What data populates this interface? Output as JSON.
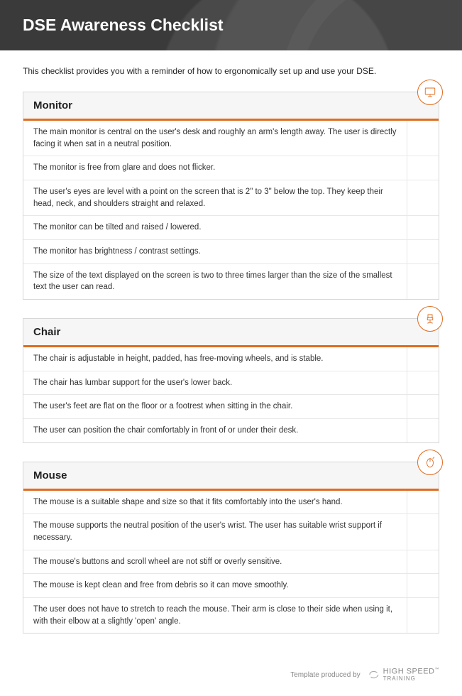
{
  "header": {
    "title": "DSE Awareness Checklist"
  },
  "intro": "This checklist provides you with a reminder of how to ergonomically set up and use your DSE.",
  "sections": [
    {
      "title": "Monitor",
      "items": [
        "The main monitor is central on the user's desk and roughly an arm's length away. The user is directly facing it when sat in a neutral position.",
        "The monitor is free from glare and does not flicker.",
        "The user's eyes are level with a point on the screen that is 2\" to 3\" below the top. They keep their head, neck, and shoulders straight and relaxed.",
        "The monitor can be tilted and raised / lowered.",
        "The monitor has brightness / contrast settings.",
        "The size of the text displayed on the screen is two to three times larger than the size of the smallest text the user can read."
      ]
    },
    {
      "title": "Chair",
      "items": [
        "The chair is adjustable in height, padded, has free-moving wheels, and is stable.",
        "The chair has lumbar support for the user's lower back.",
        "The user's feet are flat on the floor or a footrest when sitting in the chair.",
        "The user can position the chair comfortably in front of or under their desk."
      ]
    },
    {
      "title": "Mouse",
      "items": [
        "The mouse is a suitable shape and size so that it fits comfortably into the user's hand.",
        "The mouse supports the neutral position of the user's wrist. The user has suitable wrist support if necessary.",
        "The mouse's buttons and scroll wheel are not stiff or overly sensitive.",
        "The mouse is kept clean and free from debris so it can move smoothly.",
        "The user does not have to stretch to reach the mouse. Their arm is close to their side when using it, with their elbow at a slightly 'open' angle."
      ]
    }
  ],
  "footer": {
    "produced": "Template produced by",
    "brand_top": "HIGH SPEED",
    "brand_bottom": "TRAINING"
  }
}
